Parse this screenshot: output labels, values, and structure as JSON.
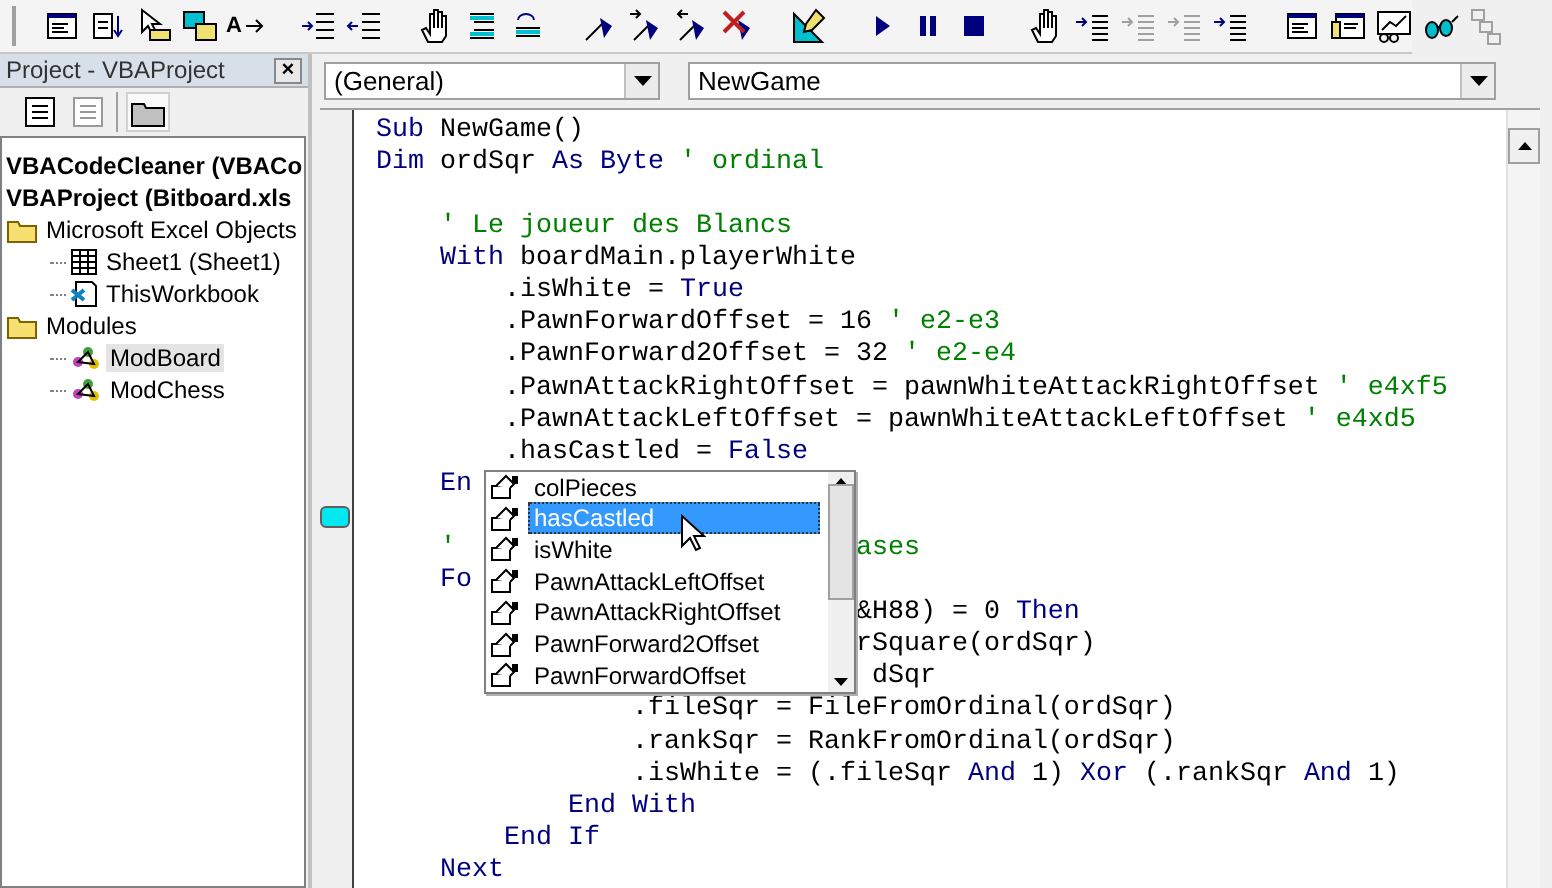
{
  "toolbar": {
    "groups": [
      [
        {
          "kind": "window-list",
          "disabled": false
        },
        {
          "kind": "document-arrow",
          "disabled": false
        },
        {
          "kind": "pointer-box",
          "disabled": false
        },
        {
          "kind": "windows",
          "disabled": false
        },
        {
          "kind": "letter-arrow",
          "disabled": false,
          "text": "A"
        }
      ],
      [
        {
          "kind": "indent",
          "disabled": false
        },
        {
          "kind": "outdent",
          "disabled": false
        }
      ],
      [
        {
          "kind": "hand",
          "disabled": false
        },
        {
          "kind": "lines",
          "disabled": false
        },
        {
          "kind": "loop",
          "disabled": false
        }
      ],
      [
        {
          "kind": "flag",
          "disabled": false
        },
        {
          "kind": "flag-next",
          "disabled": false
        },
        {
          "kind": "flag-prev",
          "disabled": false
        },
        {
          "kind": "flag-clear",
          "disabled": false
        }
      ],
      [
        {
          "kind": "ruler",
          "disabled": false
        }
      ],
      [
        {
          "kind": "play",
          "disabled": false
        },
        {
          "kind": "pause",
          "disabled": false
        },
        {
          "kind": "stop",
          "disabled": false
        }
      ],
      [
        {
          "kind": "hand",
          "disabled": false
        },
        {
          "kind": "step-into",
          "disabled": false
        },
        {
          "kind": "step-over",
          "disabled": true
        },
        {
          "kind": "step-out",
          "disabled": true
        },
        {
          "kind": "run-to",
          "disabled": false
        }
      ],
      [
        {
          "kind": "window-list",
          "disabled": false
        },
        {
          "kind": "window-yellow",
          "disabled": false
        },
        {
          "kind": "chart",
          "disabled": false
        },
        {
          "kind": "glasses",
          "disabled": false
        },
        {
          "kind": "hierarchy",
          "disabled": true
        }
      ]
    ]
  },
  "project": {
    "title": "Project - VBAProject",
    "close": "×",
    "tree": [
      {
        "label": "VBACodeCleaner (VBACo",
        "kind": "project",
        "selected": false
      },
      {
        "label": "VBAProject (Bitboard.xls",
        "kind": "project",
        "selected": false,
        "children": [
          {
            "label": "Microsoft Excel Objects",
            "kind": "folder",
            "selected": false,
            "children": [
              {
                "label": "Sheet1 (Sheet1)",
                "kind": "sheet",
                "selected": false
              },
              {
                "label": "ThisWorkbook",
                "kind": "workbook",
                "selected": false
              }
            ]
          },
          {
            "label": "Modules",
            "kind": "folder",
            "selected": false,
            "children": [
              {
                "label": "ModBoard",
                "kind": "module",
                "selected": true
              },
              {
                "label": "ModChess",
                "kind": "module",
                "selected": false
              }
            ]
          }
        ]
      }
    ]
  },
  "code_window": {
    "object_box": "(General)",
    "procedure_box": "NewGame",
    "lines": [
      {
        "segments": [
          [
            {
              "kind": "keyword",
              "text": "Sub"
            },
            {
              "kind": "plain",
              "text": " NewGame()"
            }
          ]
        ]
      },
      {
        "segments": [
          [
            {
              "kind": "keyword",
              "text": "Dim"
            },
            {
              "kind": "plain",
              "text": " ordSqr "
            },
            {
              "kind": "keyword",
              "text": "As"
            },
            {
              "kind": "keyword",
              "text": " Byte"
            },
            {
              "kind": "comment",
              "text": " ' ordinal"
            }
          ]
        ]
      },
      {
        "kind": "blank"
      },
      {
        "segments": [
          [
            {
              "kind": "comment",
              "text": "    ' Le joueur des Blancs"
            }
          ]
        ]
      },
      {
        "segments": [
          [
            {
              "kind": "keyword",
              "text": "    With"
            },
            {
              "kind": "plain",
              "text": " boardMain.playerWhite"
            }
          ]
        ]
      },
      {
        "segments": [
          [
            {
              "kind": "plain",
              "text": "        .isWhite = "
            },
            {
              "kind": "keyword",
              "text": "True"
            }
          ]
        ]
      },
      {
        "segments": [
          [
            {
              "kind": "plain",
              "text": "        .PawnForwardOffset = 16 "
            },
            {
              "kind": "comment",
              "text": "' e2-e3"
            }
          ]
        ]
      },
      {
        "segments": [
          [
            {
              "kind": "plain",
              "text": "        .PawnForward2Offset = 32 "
            },
            {
              "kind": "comment",
              "text": "' e2-e4"
            }
          ]
        ]
      },
      {
        "segments": [
          [
            {
              "kind": "plain",
              "text": "        .PawnAttackRightOffset = pawnWhiteAttackRightOffset "
            },
            {
              "kind": "comment",
              "text": "' e4xf5"
            }
          ]
        ]
      },
      {
        "segments": [
          [
            {
              "kind": "plain",
              "text": "        .PawnAttackLeftOffset = pawnWhiteAttackLeftOffset "
            },
            {
              "kind": "comment",
              "text": "' e4xd5"
            }
          ]
        ]
      },
      {
        "segments": [
          [
            {
              "kind": "plain",
              "text": "        .hasCastled = "
            },
            {
              "kind": "keyword",
              "text": "False"
            }
          ]
        ]
      },
      {
        "segments": [
          [
            {
              "kind": "keyword",
              "text": "    En"
            }
          ]
        ]
      },
      {
        "kind": "blank",
        "bookmark": true
      },
      {
        "segments": [
          [
            {
              "kind": "comment",
              "text": "    '"
            }
          ],
          [
            {
              "kind": "comment",
              "text": "                         ases"
            }
          ]
        ]
      },
      {
        "segments": [
          [
            {
              "kind": "keyword",
              "text": "    Fo"
            }
          ]
        ]
      },
      {
        "segments": [
          [
            {
              "kind": "plain",
              "text": "                              &H88) = 0 "
            },
            {
              "kind": "keyword",
              "text": "Then"
            }
          ]
        ]
      },
      {
        "segments": [
          [
            {
              "kind": "plain",
              "text": "                              rSquare(ordSqr)"
            }
          ]
        ]
      },
      {
        "segments": [
          [
            {
              "kind": "plain",
              "text": "                               dSqr"
            }
          ]
        ]
      },
      {
        "segments": [
          [
            {
              "kind": "plain",
              "text": "                .fileSqr = FileFromOrdinal(ordSqr)"
            }
          ]
        ]
      },
      {
        "segments": [
          [
            {
              "kind": "plain",
              "text": "                .rankSqr = RankFromOrdinal(ordSqr)"
            }
          ]
        ]
      },
      {
        "segments": [
          [
            {
              "kind": "plain",
              "text": "                .isWhite = (.fileSqr "
            },
            {
              "kind": "keyword",
              "text": "And"
            },
            {
              "kind": "plain",
              "text": " 1) "
            },
            {
              "kind": "keyword",
              "text": "Xor"
            },
            {
              "kind": "plain",
              "text": " (.rankSqr "
            },
            {
              "kind": "keyword",
              "text": "And"
            },
            {
              "kind": "plain",
              "text": " 1)"
            }
          ]
        ]
      },
      {
        "segments": [
          [
            {
              "kind": "keyword",
              "text": "            End With"
            }
          ]
        ]
      },
      {
        "segments": [
          [
            {
              "kind": "keyword",
              "text": "        End If"
            }
          ]
        ]
      },
      {
        "segments": [
          [
            {
              "kind": "keyword",
              "text": "    Next"
            }
          ]
        ]
      }
    ],
    "completion": [
      {
        "label": "colPieces",
        "selected": false
      },
      {
        "label": "hasCastled",
        "selected": true
      },
      {
        "label": "isWhite",
        "selected": false
      },
      {
        "label": "PawnAttackLeftOffset",
        "selected": false
      },
      {
        "label": "PawnAttackRightOffset",
        "selected": false
      },
      {
        "label": "PawnForward2Offset",
        "selected": false
      },
      {
        "label": "PawnForwardOffset",
        "selected": false
      }
    ]
  }
}
